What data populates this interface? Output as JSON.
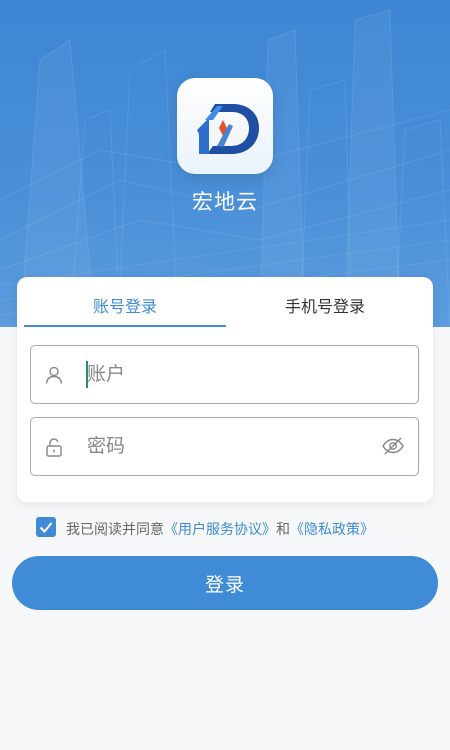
{
  "app": {
    "name": "宏地云"
  },
  "tabs": [
    {
      "label": "账号登录",
      "active": true
    },
    {
      "label": "手机号登录",
      "active": false
    }
  ],
  "fields": {
    "account": {
      "placeholder": "账户",
      "value": "",
      "icon": "user-icon"
    },
    "password": {
      "placeholder": "密码",
      "value": "",
      "icon": "lock-icon",
      "toggle_icon": "eye-hidden-icon"
    }
  },
  "agreement": {
    "checked": true,
    "prefix": "我已阅读并同意",
    "terms_link": "《用户服务协议》",
    "conjunction": "和",
    "privacy_link": "《隐私政策》"
  },
  "login_button": {
    "label": "登录"
  },
  "colors": {
    "primary": "#3f8bd6",
    "hero_top": "#3d86d3",
    "page_background": "#f6f7f9",
    "text_dark": "#333333",
    "text_muted": "#666666"
  }
}
